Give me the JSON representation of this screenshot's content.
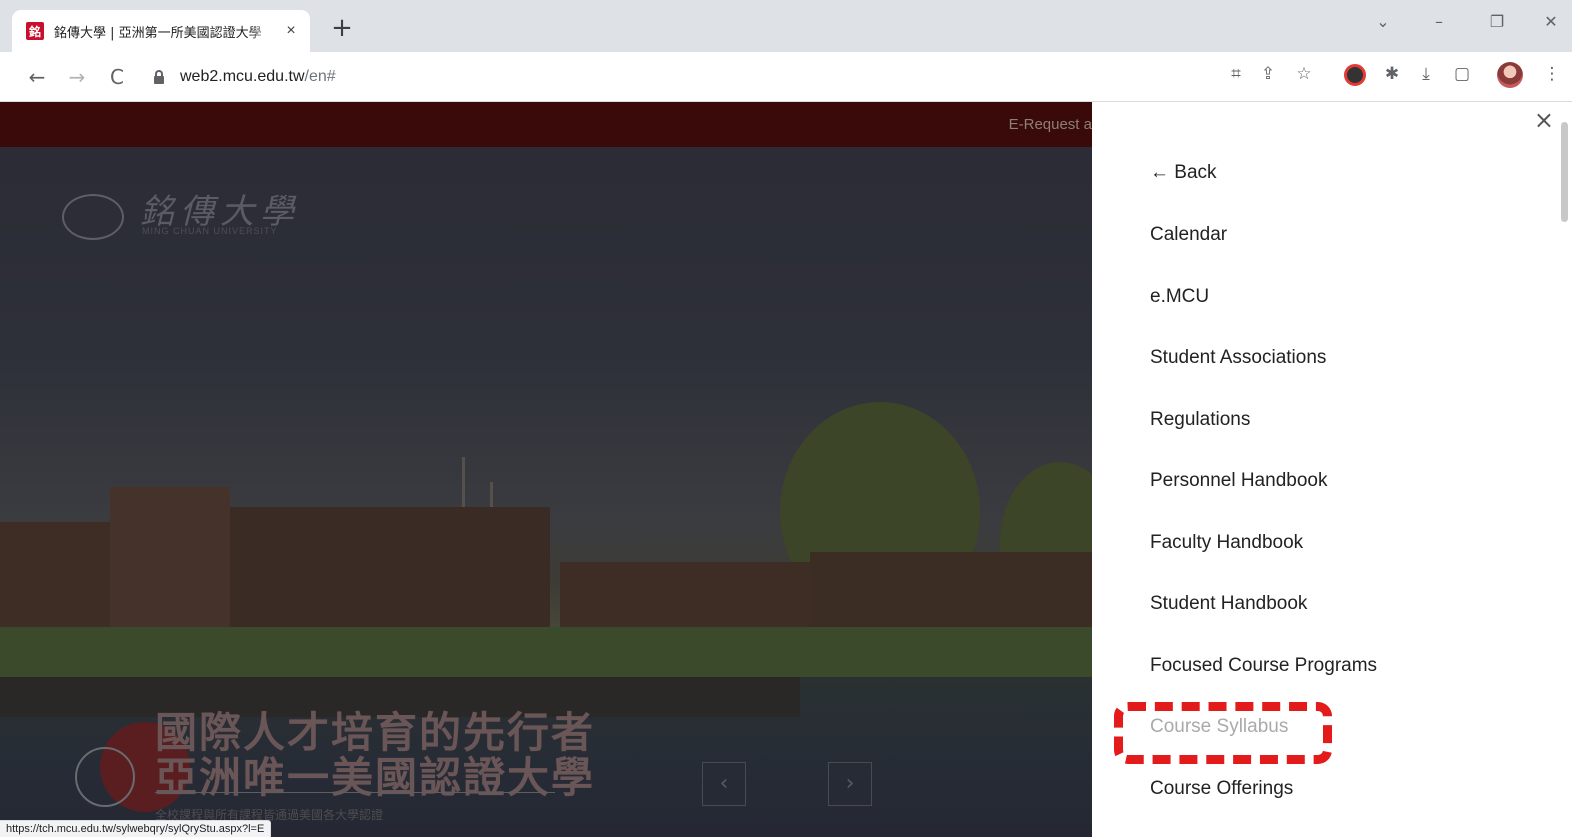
{
  "browser": {
    "tab": {
      "favicon": "銘",
      "title": "銘傳大學 | 亞洲第一所美國認證大學",
      "close": "×"
    },
    "new_tab": "+",
    "window_controls": {
      "menu": "⌄",
      "minimize": "–",
      "restore": "❐",
      "close": "✕"
    },
    "nav": {
      "back": "←",
      "forward": "→",
      "reload": "C"
    },
    "address": {
      "host": "web2.mcu.edu.tw",
      "path": "/en#"
    },
    "toolbar_icons": [
      "translate-icon",
      "share-icon",
      "star-icon",
      "extension-icon",
      "puzzle-icon",
      "download-icon",
      "sidepanel-icon",
      "avatar",
      "kebab-menu-icon"
    ]
  },
  "page": {
    "topbar_link": "E-Request a",
    "logo": {
      "chinese": "銘傳大學",
      "english": "MING CHUAN UNIVERSITY"
    },
    "slogan": {
      "line1": "國際人才培育的先行者",
      "line2": "亞洲唯一美國認證大學",
      "sub": "全校課程與所有課程皆通過美國各大學認證"
    },
    "carousel": {
      "prev": "‹",
      "next": "›"
    },
    "status_url": "https://tch.mcu.edu.tw/sylwebqry/sylQryStu.aspx?l=E"
  },
  "side_menu": {
    "close": "×",
    "back": "← Back",
    "items": [
      "Calendar",
      "e.MCU",
      "Student Associations",
      "Regulations",
      "Personnel Handbook",
      "Faculty Handbook",
      "Student Handbook",
      "Focused Course Programs",
      "Course Syllabus",
      "Course Offerings"
    ],
    "hovered_item": "Course Syllabus",
    "highlight_color": "#e31b1b"
  }
}
